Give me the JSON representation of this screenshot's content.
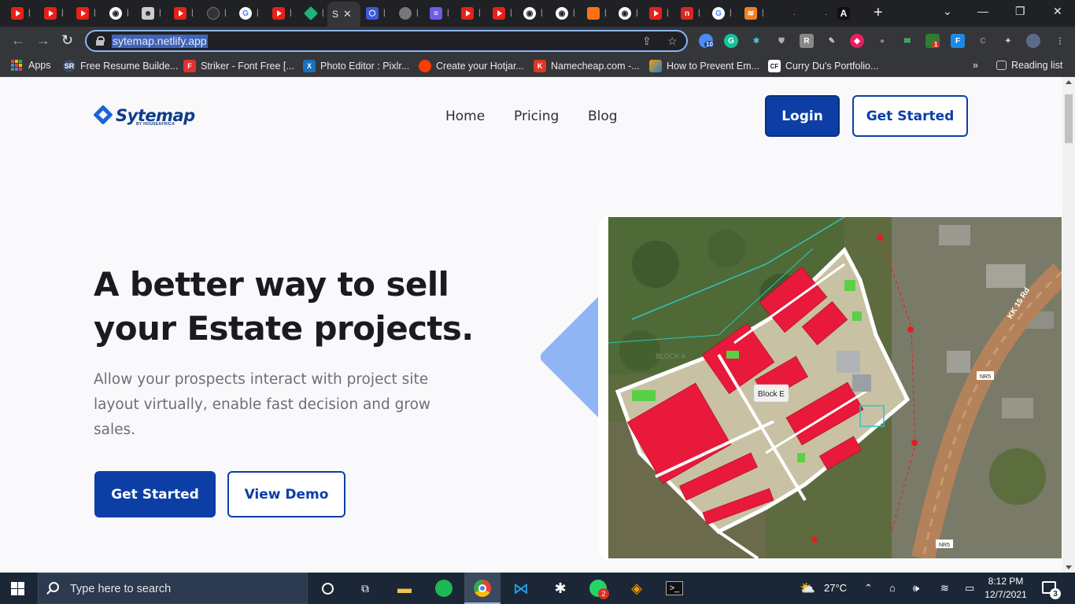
{
  "browser": {
    "url": "sytemap.netlify.app",
    "active_tab_label": "S",
    "tabs": [
      {
        "icon": "youtube-icon"
      },
      {
        "icon": "youtube-icon"
      },
      {
        "icon": "youtube-icon"
      },
      {
        "icon": "github-icon"
      },
      {
        "icon": "contributors-icon"
      },
      {
        "icon": "youtube-icon"
      },
      {
        "icon": "github-icon"
      },
      {
        "icon": "google-icon"
      },
      {
        "icon": "youtube-icon"
      },
      {
        "icon": "diamond-icon"
      },
      {
        "icon": "sytemap-tab",
        "active": true
      },
      {
        "icon": "hexagon-icon"
      },
      {
        "icon": "globe-icon"
      },
      {
        "icon": "list-icon"
      },
      {
        "icon": "youtube-icon"
      },
      {
        "icon": "youtube-icon"
      },
      {
        "icon": "github-icon"
      },
      {
        "icon": "github-icon"
      },
      {
        "icon": "orange-app-icon"
      },
      {
        "icon": "github-icon"
      },
      {
        "icon": "youtube-icon"
      },
      {
        "icon": "red-square-icon"
      },
      {
        "icon": "google-icon"
      },
      {
        "icon": "stackoverflow-icon"
      },
      {
        "icon": "blank-icon"
      },
      {
        "icon": "blank-icon"
      },
      {
        "icon": "a-letter-icon"
      }
    ],
    "extensions_badge": "10",
    "ext_badge_red": "1",
    "bookmarks": [
      {
        "label": "Apps",
        "icon": "apps-grid-icon"
      },
      {
        "label": "Free Resume Builde...",
        "icon": "sr-icon",
        "icon_text": "SR"
      },
      {
        "label": "Striker - Font Free [...",
        "icon": "f-icon",
        "icon_text": "F"
      },
      {
        "label": "Photo Editor : Pixlr...",
        "icon": "pixlr-icon",
        "icon_text": "X"
      },
      {
        "label": "Create your Hotjar...",
        "icon": "hotjar-icon"
      },
      {
        "label": "Namecheap.com -...",
        "icon": "namecheap-icon",
        "icon_text": "K"
      },
      {
        "label": "How to Prevent Em...",
        "icon": "prevent-icon"
      },
      {
        "label": "Curry Du's Portfolio...",
        "icon": "cf-icon",
        "icon_text": "CF"
      }
    ],
    "reading_list": "Reading list",
    "overflow": "»"
  },
  "site": {
    "logo": {
      "name": "Sytemap",
      "sub": "BY HOUSEAFRICA"
    },
    "nav": [
      "Home",
      "Pricing",
      "Blog"
    ],
    "login": "Login",
    "get_started": "Get Started",
    "hero": {
      "title": "A better way to sell your Estate projects.",
      "subtitle": "Allow your prospects interact with project site layout virtually, enable fast decision and grow sales.",
      "cta_primary": "Get Started",
      "cta_secondary": "View Demo"
    },
    "map": {
      "block_e_label": "Block E",
      "block_a_label": "BLOCK A",
      "road_label": "KK 15 Rd",
      "nr5_label": "NR5"
    }
  },
  "taskbar": {
    "search_placeholder": "Type here to search",
    "weather": "27°C",
    "time": "8:12 PM",
    "date": "12/7/2021",
    "notifications": "3",
    "whatsapp_badge": "2"
  }
}
